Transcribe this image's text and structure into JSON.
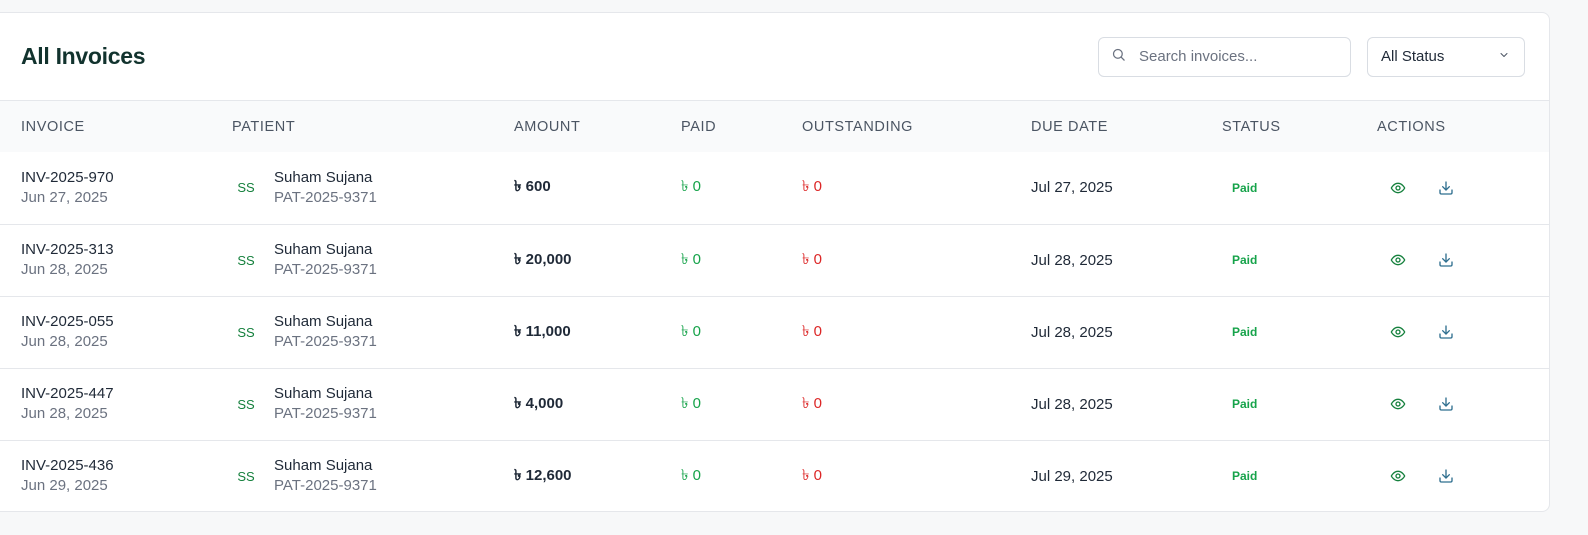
{
  "header": {
    "title": "All Invoices",
    "search_placeholder": "Search invoices...",
    "status_filter": "All Status"
  },
  "columns": [
    "INVOICE",
    "PATIENT",
    "AMOUNT",
    "PAID",
    "OUTSTANDING",
    "DUE DATE",
    "STATUS",
    "ACTIONS"
  ],
  "rows": [
    {
      "invoice": "INV-2025-970",
      "date": "Jun 27, 2025",
      "initials": "SS",
      "patient": "Suham Sujana",
      "patient_id": "PAT-2025-9371",
      "amount": "৳ 600",
      "paid": "৳ 0",
      "outstanding": "৳ 0",
      "due": "Jul 27, 2025",
      "status": "Paid"
    },
    {
      "invoice": "INV-2025-313",
      "date": "Jun 28, 2025",
      "initials": "SS",
      "patient": "Suham Sujana",
      "patient_id": "PAT-2025-9371",
      "amount": "৳ 20,000",
      "paid": "৳ 0",
      "outstanding": "৳ 0",
      "due": "Jul 28, 2025",
      "status": "Paid"
    },
    {
      "invoice": "INV-2025-055",
      "date": "Jun 28, 2025",
      "initials": "SS",
      "patient": "Suham Sujana",
      "patient_id": "PAT-2025-9371",
      "amount": "৳ 11,000",
      "paid": "৳ 0",
      "outstanding": "৳ 0",
      "due": "Jul 28, 2025",
      "status": "Paid"
    },
    {
      "invoice": "INV-2025-447",
      "date": "Jun 28, 2025",
      "initials": "SS",
      "patient": "Suham Sujana",
      "patient_id": "PAT-2025-9371",
      "amount": "৳ 4,000",
      "paid": "৳ 0",
      "outstanding": "৳ 0",
      "due": "Jul 28, 2025",
      "status": "Paid"
    },
    {
      "invoice": "INV-2025-436",
      "date": "Jun 29, 2025",
      "initials": "SS",
      "patient": "Suham Sujana",
      "patient_id": "PAT-2025-9371",
      "amount": "৳ 12,600",
      "paid": "৳ 0",
      "outstanding": "৳ 0",
      "due": "Jul 29, 2025",
      "status": "Paid"
    }
  ],
  "icons": {
    "search": "search-icon",
    "dropdown": "chevron-down-icon",
    "view": "eye-icon",
    "download": "download-icon"
  },
  "colors": {
    "title": "#12332e",
    "accent_green": "#16a34a",
    "outstanding_red": "#dc2626"
  }
}
